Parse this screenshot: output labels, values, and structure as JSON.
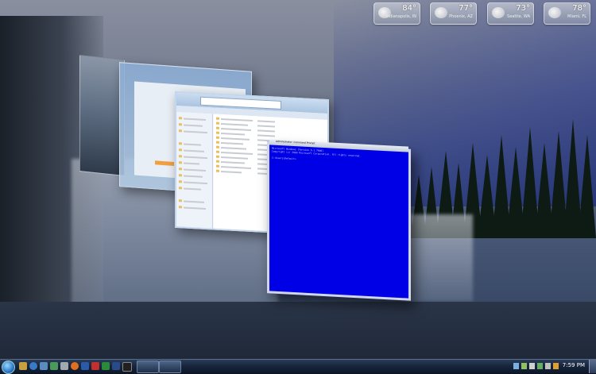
{
  "gadgets": [
    {
      "temp": "84°",
      "city": "Indianapolis, IN"
    },
    {
      "temp": "77°",
      "city": "Phoenix, AZ"
    },
    {
      "temp": "73°",
      "city": "Seattle, WA"
    },
    {
      "temp": "78°",
      "city": "Miami, FL"
    }
  ],
  "cmd_window": {
    "title": "Administrator: Command Prompt",
    "lines": [
      "Microsoft Windows [Version 6.1.7600]",
      "Copyright (c) 2009 Microsoft Corporation.  All rights reserved.",
      "",
      "C:\\Users\\Default>"
    ]
  },
  "taskbar": {
    "clock": "7:59 PM",
    "pinned_icons": [
      "folder-icon",
      "ie-icon",
      "media-icon",
      "firefox-icon",
      "word-icon",
      "excel-icon",
      "photoshop-icon",
      "cmd-icon"
    ]
  }
}
